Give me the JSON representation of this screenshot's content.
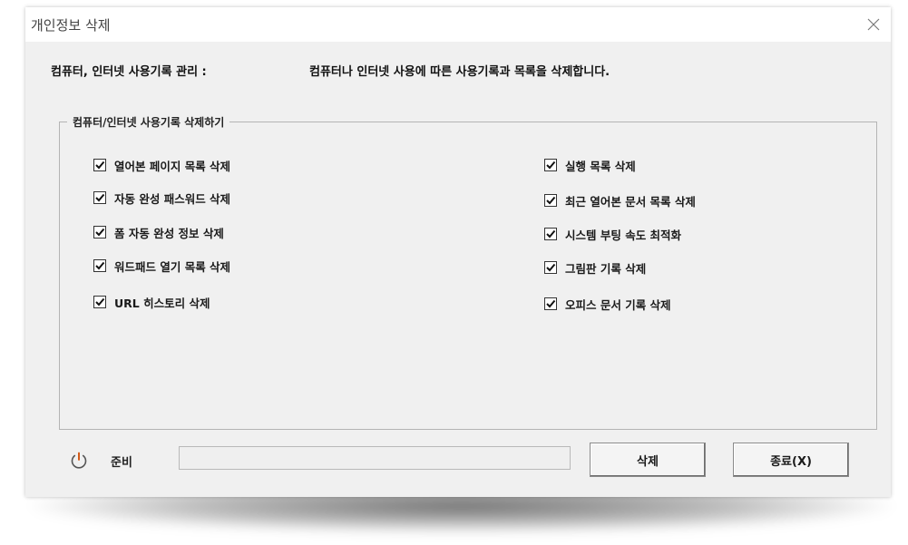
{
  "window": {
    "title": "개인정보 삭제",
    "close_icon": "close-icon"
  },
  "header": {
    "label": "컴퓨터, 인터넷 사용기록 관리 :",
    "description": "컴퓨터나 인터넷 사용에 따른 사용기록과 목록을 삭제합니다."
  },
  "group": {
    "legend": "컴퓨터/인터넷 사용기록 삭제하기",
    "left_options": [
      {
        "label": "열어본 페이지 목록 삭제",
        "checked": true
      },
      {
        "label": "자동 완성 패스워드 삭제",
        "checked": true
      },
      {
        "label": "폼 자동 완성 정보 삭제",
        "checked": true
      },
      {
        "label": "워드패드 열기 목록 삭제",
        "checked": true
      },
      {
        "label": "URL 히스토리 삭제",
        "checked": true
      }
    ],
    "right_options": [
      {
        "label": "실행 목록 삭제",
        "checked": true
      },
      {
        "label": "최근 열어본 문서 목록 삭제",
        "checked": true
      },
      {
        "label": "시스템 부팅 속도 최적화",
        "checked": true
      },
      {
        "label": "그림판 기록 삭제",
        "checked": true
      },
      {
        "label": "오피스 문서 기록 삭제",
        "checked": true
      }
    ]
  },
  "status": {
    "icon": "power-icon",
    "text": "준비",
    "progress": 0
  },
  "buttons": {
    "delete_label": "삭제",
    "exit_label": "종료(X)"
  },
  "colors": {
    "window_bg": "#f0f0f0",
    "titlebar_bg": "#ffffff"
  }
}
